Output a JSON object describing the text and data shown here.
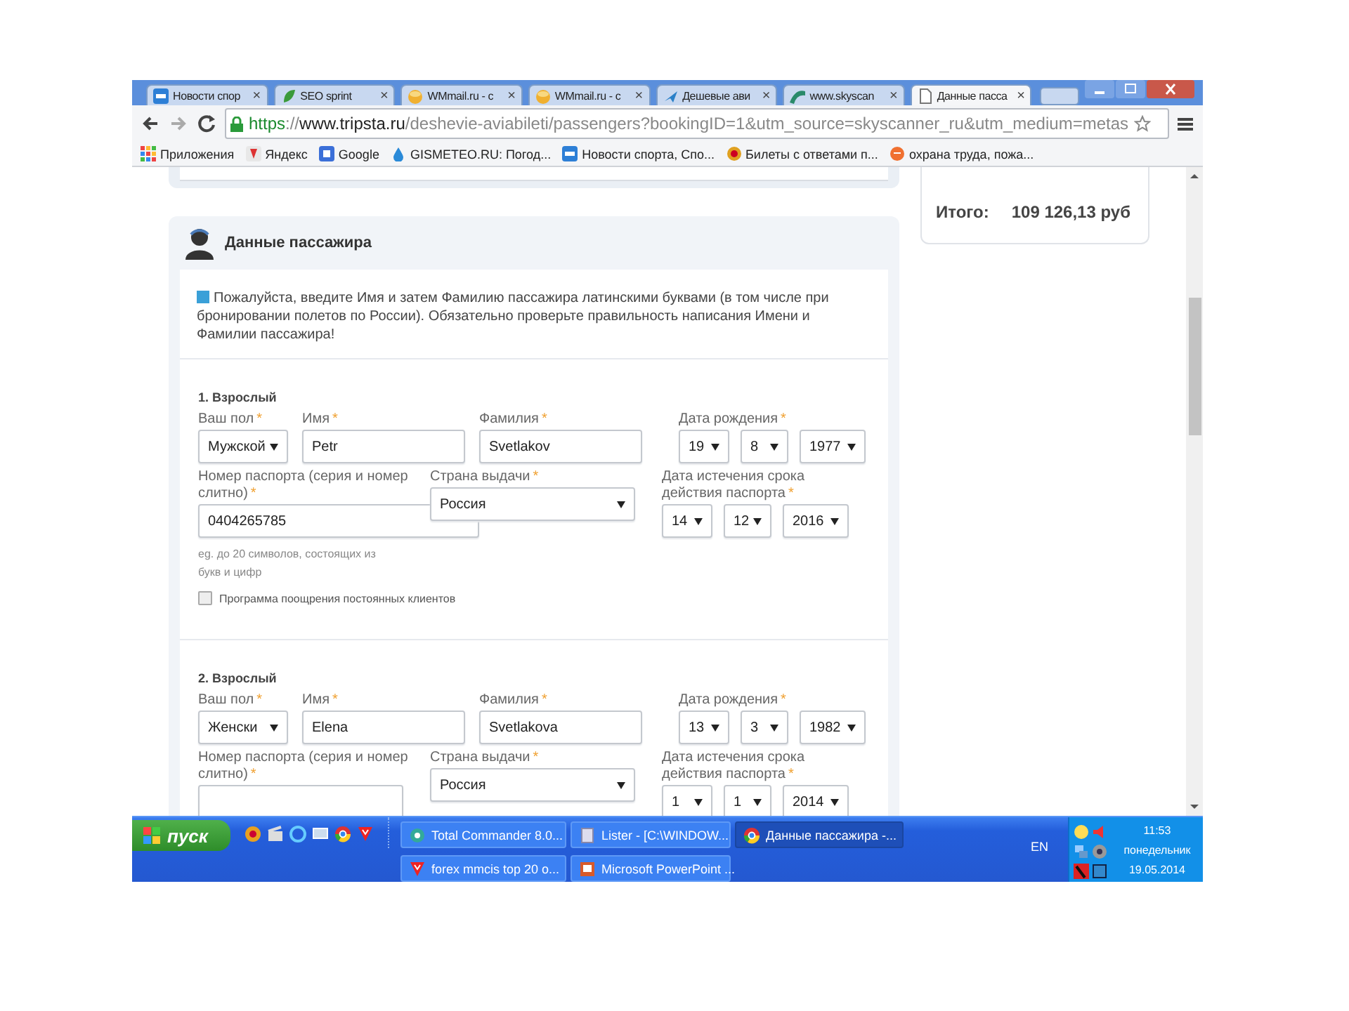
{
  "browser": {
    "tabs": [
      {
        "title": "Новости спор",
        "selected": false
      },
      {
        "title": "SEO sprint",
        "selected": false
      },
      {
        "title": "WMmail.ru - c",
        "selected": false
      },
      {
        "title": "WMmail.ru - c",
        "selected": false
      },
      {
        "title": "Дешевые ави",
        "selected": false
      },
      {
        "title": "www.skyscan",
        "selected": false
      },
      {
        "title": "Данные пасса",
        "selected": true
      }
    ],
    "close_glyph": "×",
    "address": {
      "scheme": "https",
      "separator": "://",
      "host": "www.tripsta.ru",
      "path": "/deshevie-aviabileti/passengers?bookingID=1&utm_source=skyscanner_ru&utm_medium=metas"
    },
    "bookmarks": [
      {
        "label": "Приложения"
      },
      {
        "label": "Яндекс"
      },
      {
        "label": "Google"
      },
      {
        "label": "GISMETEO.RU: Погод..."
      },
      {
        "label": "Новости спорта, Спо..."
      },
      {
        "label": "Билеты с ответами п..."
      },
      {
        "label": "охрана труда, пожа..."
      }
    ]
  },
  "summary": {
    "total_label": "Итого:",
    "total_value": "109 126,13 руб"
  },
  "passenger_section": {
    "title": "Данные пассажира",
    "notice": "Пожалуйста, введите Имя и затем Фамилию пассажира латинскими буквами (в том числе при бронировании полетов по России). Обязательно проверьте правильность написания Имени и Фамилии пассажира!",
    "passengers": [
      {
        "heading": "1. Взрослый",
        "fields": [
          {
            "label": "Ваш пол",
            "mark": "*",
            "kind": "select",
            "value": "Мужской"
          },
          {
            "label": "Имя",
            "mark": "*",
            "kind": "text",
            "value": "Petr"
          },
          {
            "label": "Фамилия",
            "mark": "*",
            "kind": "text",
            "value": "Svetlakov"
          },
          {
            "label": "Дата рождения",
            "mark": "*",
            "kind": "date",
            "parts": [
              "19",
              "8",
              "1977"
            ]
          },
          {
            "label": "Номер паспорта (серия и номер слитно)",
            "mark": "*",
            "kind": "text",
            "value": "0404265785"
          },
          {
            "label": "Страна выдачи",
            "mark": "*",
            "kind": "select",
            "value": "Россия"
          },
          {
            "label": "Дата истечения срока действия паспорта",
            "mark": "*",
            "kind": "date",
            "parts": [
              "14",
              "12",
              "2016"
            ]
          }
        ],
        "hint": "eg. до 20 символов, состоящих из букв и цифр",
        "loyalty": {
          "label": "Программа поощрения постоянных клиентов",
          "checked": false
        }
      },
      {
        "heading": "2. Взрослый",
        "fields": [
          {
            "label": "Ваш пол",
            "mark": "*",
            "kind": "select",
            "value": "Женски"
          },
          {
            "label": "Имя",
            "mark": "*",
            "kind": "text",
            "value": "Elena"
          },
          {
            "label": "Фамилия",
            "mark": "*",
            "kind": "text",
            "value": "Svetlakova"
          },
          {
            "label": "Дата рождения",
            "mark": "*",
            "kind": "date",
            "parts": [
              "13",
              "3",
              "1982"
            ]
          },
          {
            "label": "Номер паспорта (серия и номер слитно)",
            "mark": "*",
            "kind": "text"
          },
          {
            "label": "Страна выдачи",
            "mark": "*",
            "kind": "select",
            "value": "Россия"
          },
          {
            "label": "Дата истечения срока действия паспорта",
            "mark": "*",
            "kind": "date",
            "parts": [
              "1",
              "1",
              "2014"
            ]
          }
        ]
      }
    ]
  },
  "taskbar": {
    "start": "пуск",
    "tasks": [
      {
        "title": "Total Commander 8.0...",
        "active": false
      },
      {
        "title": "Lister - [C:\\WINDOW...",
        "active": false
      },
      {
        "title": "Данные пассажира -...",
        "active": true
      },
      {
        "title": "forex mmcis top 20 o...",
        "active": false
      },
      {
        "title": "Microsoft PowerPoint ...",
        "active": false
      }
    ],
    "language": "EN",
    "time": "11:53",
    "day": "понедельник",
    "date": "19.05.2014"
  }
}
